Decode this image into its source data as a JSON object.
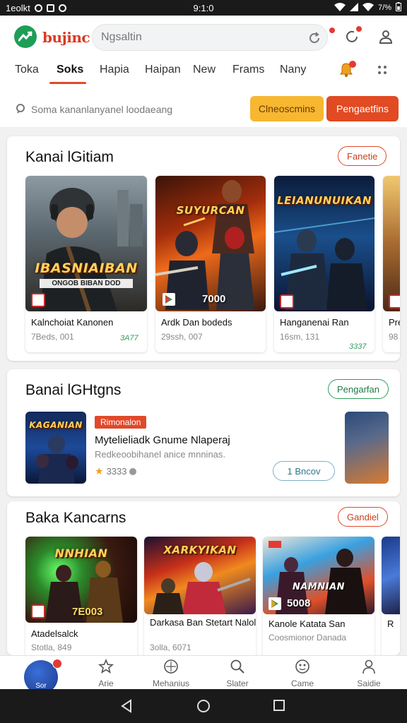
{
  "status_bar": {
    "left_text": "1eolkt",
    "time": "9:1:0",
    "battery": "7/%"
  },
  "header": {
    "logo_text": "bujinc",
    "search_placeholder": "Ngsaltin"
  },
  "tabs": [
    {
      "label": "Toka"
    },
    {
      "label": "Soks"
    },
    {
      "label": "Hapia"
    },
    {
      "label": "Haipan"
    },
    {
      "label": "New"
    },
    {
      "label": "Frams"
    },
    {
      "label": "Nany"
    }
  ],
  "filter": {
    "search_text": "Soma kananlanyanel loodaeang",
    "btn_yellow": "Clneoscmins",
    "btn_orange": "Pengaetfins"
  },
  "section1": {
    "title": "Kanai lGitiam",
    "action": "Fanetie",
    "games": [
      {
        "art_title": "IBASNIAIBAN",
        "art_sub": "ONGOB BIBAN DOD",
        "name": "Kalnchoiat Kanonen",
        "meta": "7Beds, 001",
        "price": "3A77"
      },
      {
        "art_title": "SUYURCAN",
        "score": "7000",
        "name": "Ardk Dan bodeds",
        "meta": "29ssh, 007",
        "price": ""
      },
      {
        "art_title": "LEIANUNUIKAN",
        "name": "Hanganenai Ran",
        "meta": "16sm, 131",
        "price": "3337"
      },
      {
        "art_title": "",
        "name": "Pre",
        "meta": "98",
        "price": ""
      }
    ]
  },
  "section2": {
    "title": "Banai lGHtgns",
    "action": "Pengarfan",
    "featured": {
      "art_title": "KAGANIAN",
      "tag": "Rimonalon",
      "title": "Mytelieliadk Gnume Nlaperaj",
      "desc": "Redkeoobihanel anice mnninas.",
      "rating": "3333",
      "cta": "1 Bncov"
    }
  },
  "section3": {
    "title": "Baka Kancarns",
    "action": "Gandiel",
    "games": [
      {
        "art_title": "NNHIAN",
        "score": "7E003",
        "name": "Atadelsalck",
        "meta": "Stotla, 849"
      },
      {
        "art_title": "XARKYIKAN",
        "name": "Darkasa Ban Stetart Nalolanar",
        "meta": "3olla, 6071"
      },
      {
        "art_title": "NAMNIAN",
        "score": "5008",
        "name": "Kanole Katata San",
        "meta": "Coosmionor Danada"
      },
      {
        "art_title": "",
        "name": "R",
        "meta": ""
      }
    ]
  },
  "bottom_nav": {
    "fab_label": "Sor",
    "items": [
      {
        "label": "Arie"
      },
      {
        "label": "Mehanius"
      },
      {
        "label": "Slater"
      },
      {
        "label": "Came"
      },
      {
        "label": "Saidie"
      }
    ]
  },
  "colors": {
    "brand_green": "#1e9e57",
    "accent_orange": "#e14a22",
    "accent_yellow": "#f7b731",
    "positive_green": "#2e9e5e"
  }
}
